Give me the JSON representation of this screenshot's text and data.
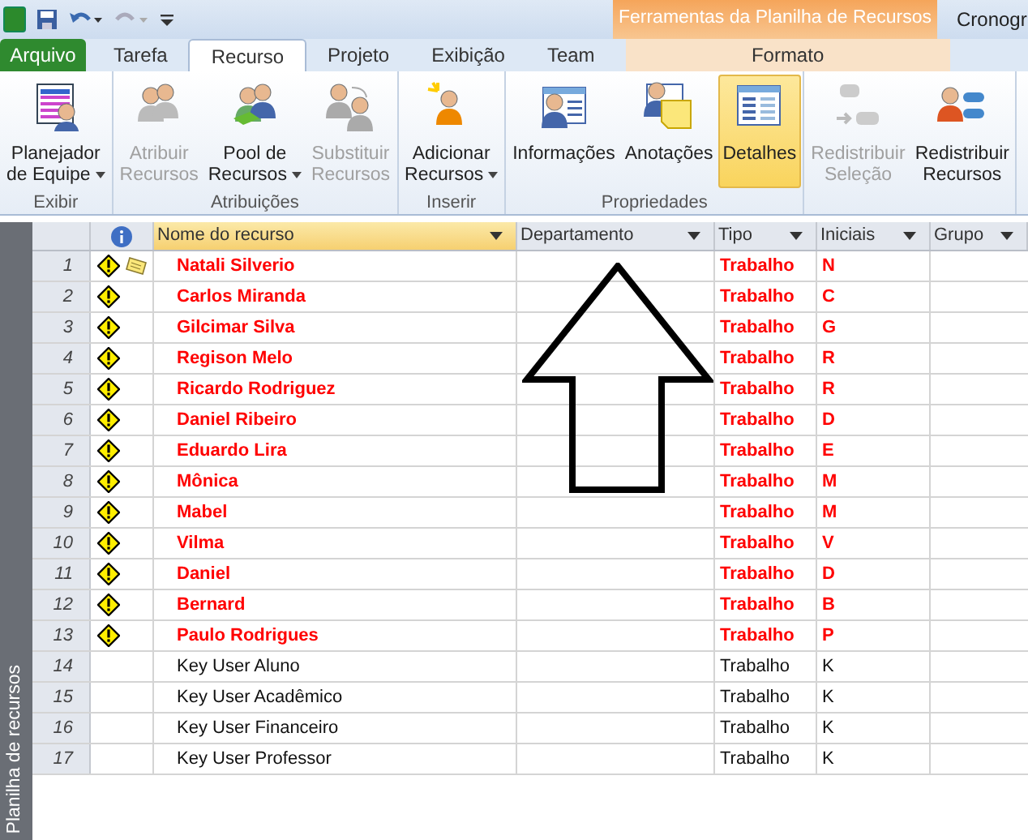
{
  "title_bar": {
    "context_tab": "Ferramentas da Planilha de Recursos",
    "window_title": "Cronogr"
  },
  "tabs": [
    {
      "label": "Arquivo",
      "kind": "file",
      "selected": false
    },
    {
      "label": "Tarefa",
      "kind": "tab",
      "selected": false
    },
    {
      "label": "Recurso",
      "kind": "tab",
      "selected": true
    },
    {
      "label": "Projeto",
      "kind": "tab",
      "selected": false
    },
    {
      "label": "Exibição",
      "kind": "tab",
      "selected": false
    },
    {
      "label": "Team",
      "kind": "tab",
      "selected": false
    },
    {
      "label": "Formato",
      "kind": "context",
      "selected": false
    }
  ],
  "ribbon_groups": [
    {
      "name": "Exibir",
      "buttons": [
        {
          "kind": "planner",
          "lines": [
            "Planejador",
            "de Equipe"
          ],
          "dropdown": true,
          "disabled": false,
          "selected": false
        }
      ]
    },
    {
      "name": "Atribuições",
      "buttons": [
        {
          "kind": "people",
          "lines": [
            "Atribuir",
            "Recursos"
          ],
          "dropdown": false,
          "disabled": true,
          "selected": false
        },
        {
          "kind": "pool",
          "lines": [
            "Pool de",
            "Recursos"
          ],
          "dropdown": true,
          "disabled": false,
          "selected": false
        },
        {
          "kind": "replace",
          "lines": [
            "Substituir",
            "Recursos"
          ],
          "dropdown": false,
          "disabled": true,
          "selected": false
        }
      ]
    },
    {
      "name": "Inserir",
      "buttons": [
        {
          "kind": "add",
          "lines": [
            "Adicionar",
            "Recursos"
          ],
          "dropdown": true,
          "disabled": false,
          "selected": false
        }
      ]
    },
    {
      "name": "Propriedades",
      "buttons": [
        {
          "kind": "info",
          "lines": [
            "Informações"
          ],
          "dropdown": false,
          "disabled": false,
          "selected": false
        },
        {
          "kind": "notes",
          "lines": [
            "Anotações"
          ],
          "dropdown": false,
          "disabled": false,
          "selected": false
        },
        {
          "kind": "details",
          "lines": [
            "Detalhes"
          ],
          "dropdown": false,
          "disabled": false,
          "selected": true
        }
      ]
    },
    {
      "buttons": [
        {
          "kind": "levelsel",
          "lines": [
            "Redistribuir",
            "Seleção"
          ],
          "dropdown": false,
          "disabled": true,
          "selected": false
        },
        {
          "kind": "level",
          "lines": [
            "Redistribuir",
            "Recursos"
          ],
          "dropdown": false,
          "disabled": false,
          "selected": false
        }
      ]
    }
  ],
  "side_label": "Planilha de recursos",
  "table": {
    "columns": [
      {
        "label": "Nome do recurso",
        "selected": true
      },
      {
        "label": "Departamento",
        "selected": false
      },
      {
        "label": "Tipo",
        "selected": false
      },
      {
        "label": "Iniciais",
        "selected": false
      },
      {
        "label": "Grupo",
        "selected": false
      }
    ],
    "rows": [
      {
        "id": "1",
        "name": "Natali Silverio",
        "type": "Trabalho",
        "initials": "N",
        "overallocated": true,
        "note": true
      },
      {
        "id": "2",
        "name": "Carlos Miranda",
        "type": "Trabalho",
        "initials": "C",
        "overallocated": true,
        "note": false
      },
      {
        "id": "3",
        "name": "Gilcimar Silva",
        "type": "Trabalho",
        "initials": "G",
        "overallocated": true,
        "note": false
      },
      {
        "id": "4",
        "name": "Regison Melo",
        "type": "Trabalho",
        "initials": "R",
        "overallocated": true,
        "note": false
      },
      {
        "id": "5",
        "name": "Ricardo Rodriguez",
        "type": "Trabalho",
        "initials": "R",
        "overallocated": true,
        "note": false
      },
      {
        "id": "6",
        "name": "Daniel Ribeiro",
        "type": "Trabalho",
        "initials": "D",
        "overallocated": true,
        "note": false
      },
      {
        "id": "7",
        "name": "Eduardo Lira",
        "type": "Trabalho",
        "initials": "E",
        "overallocated": true,
        "note": false
      },
      {
        "id": "8",
        "name": "Mônica",
        "type": "Trabalho",
        "initials": "M",
        "overallocated": true,
        "note": false
      },
      {
        "id": "9",
        "name": "Mabel",
        "type": "Trabalho",
        "initials": "M",
        "overallocated": true,
        "note": false
      },
      {
        "id": "10",
        "name": "Vilma",
        "type": "Trabalho",
        "initials": "V",
        "overallocated": true,
        "note": false
      },
      {
        "id": "11",
        "name": "Daniel",
        "type": "Trabalho",
        "initials": "D",
        "overallocated": true,
        "note": false
      },
      {
        "id": "12",
        "name": "Bernard",
        "type": "Trabalho",
        "initials": "B",
        "overallocated": true,
        "note": false
      },
      {
        "id": "13",
        "name": "Paulo Rodrigues",
        "type": "Trabalho",
        "initials": "P",
        "overallocated": true,
        "note": false
      },
      {
        "id": "14",
        "name": "Key User Aluno",
        "type": "Trabalho",
        "initials": "K",
        "overallocated": false,
        "note": false
      },
      {
        "id": "15",
        "name": "Key User Acadêmico",
        "type": "Trabalho",
        "initials": "K",
        "overallocated": false,
        "note": false
      },
      {
        "id": "16",
        "name": "Key User Financeiro",
        "type": "Trabalho",
        "initials": "K",
        "overallocated": false,
        "note": false
      },
      {
        "id": "17",
        "name": "Key User Professor",
        "type": "Trabalho",
        "initials": "K",
        "overallocated": false,
        "note": false
      }
    ]
  }
}
